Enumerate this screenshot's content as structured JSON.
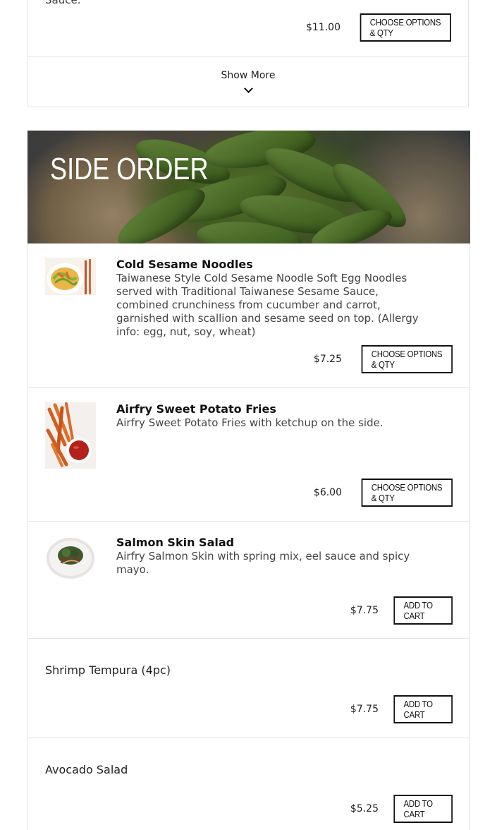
{
  "previous_section": {
    "desc_tail": "Sauce.",
    "price": "$11.00",
    "button_label": "Choose Options & Qty",
    "show_more_label": "Show More"
  },
  "section": {
    "title": "SIDE ORDER"
  },
  "items": [
    {
      "name": "Cold Sesame Noodles",
      "description": "Taiwanese Style Cold Sesame Noodle Soft Egg Noodles served with Traditional Taiwanese Sesame Sauce, combined crunchiness from cucumber and carrot, garnished with scallion and sesame seed on top. (Allergy info: egg, nut, soy, wheat)",
      "price": "$7.25",
      "button_label": "Choose Options & Qty"
    },
    {
      "name": "Airfry Sweet Potato Fries",
      "description": "Airfry Sweet Potato Fries with ketchup on the side.",
      "price": "$6.00",
      "button_label": "Choose Options & Qty"
    },
    {
      "name": "Salmon Skin Salad",
      "description": "Airfry Salmon Skin with spring mix, eel sauce and spicy mayo.",
      "price": "$7.75",
      "button_label": "Add to Cart"
    },
    {
      "name": "Shrimp Tempura (4pc)",
      "price": "$7.75",
      "button_label": "Add to Cart"
    },
    {
      "name": "Avocado Salad",
      "price": "$5.25",
      "button_label": "Add to Cart"
    }
  ]
}
